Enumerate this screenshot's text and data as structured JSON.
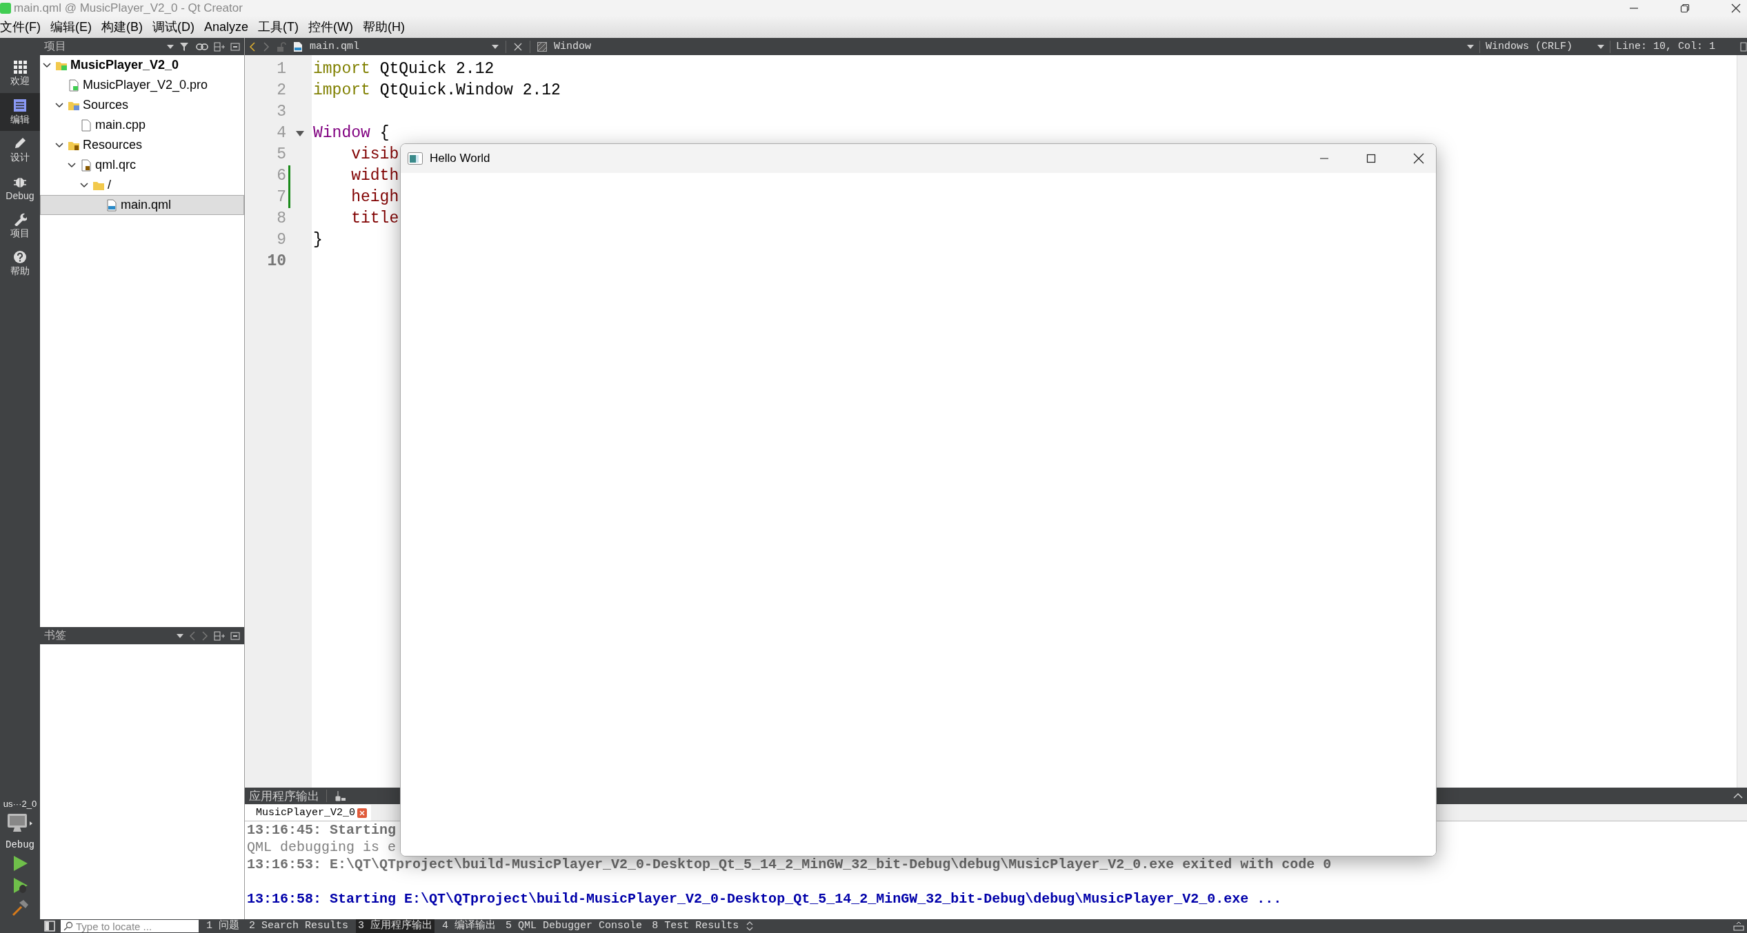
{
  "window": {
    "title": "main.qml @ MusicPlayer_V2_0 - Qt Creator"
  },
  "menu": [
    "文件(F)",
    "编辑(E)",
    "构建(B)",
    "调试(D)",
    "Analyze",
    "工具(T)",
    "控件(W)",
    "帮助(H)"
  ],
  "mode_bar": {
    "items": [
      {
        "label": "欢迎",
        "kind": "welcome",
        "selected": false
      },
      {
        "label": "编辑",
        "kind": "edit",
        "selected": true
      },
      {
        "label": "设计",
        "kind": "design",
        "selected": false
      },
      {
        "label": "Debug",
        "kind": "debug",
        "selected": false
      },
      {
        "label": "项目",
        "kind": "projects",
        "selected": false
      },
      {
        "label": "帮助",
        "kind": "help",
        "selected": false
      }
    ],
    "target": {
      "project": "us···2_0",
      "build": "Debug"
    }
  },
  "project_panel": {
    "title": "项目",
    "tree": [
      {
        "label": "MusicPlayer_V2_0",
        "kind": "project",
        "expanded": true,
        "selected": false,
        "children": [
          {
            "label": "MusicPlayer_V2_0.pro",
            "kind": "pro",
            "selected": false
          },
          {
            "label": "Sources",
            "kind": "sources",
            "expanded": true,
            "selected": false,
            "children": [
              {
                "label": "main.cpp",
                "kind": "cpp",
                "selected": false
              }
            ]
          },
          {
            "label": "Resources",
            "kind": "resources",
            "expanded": true,
            "selected": false,
            "children": [
              {
                "label": "qml.qrc",
                "kind": "qrc",
                "expanded": true,
                "selected": false,
                "children": [
                  {
                    "label": "/",
                    "kind": "folder",
                    "expanded": true,
                    "selected": false,
                    "children": [
                      {
                        "label": "main.qml",
                        "kind": "qml",
                        "selected": true
                      }
                    ]
                  }
                ]
              }
            ]
          }
        ]
      }
    ]
  },
  "bookmarks_panel": {
    "title": "书签"
  },
  "editor": {
    "file": "main.qml",
    "symbol": "Window",
    "line_ending": "Windows (CRLF)",
    "position": "Line: 10, Col: 1",
    "lines": [
      {
        "number": "1",
        "current": false,
        "modified": false,
        "foldable": false,
        "tokens": [
          {
            "kind": "keyword",
            "text": "import"
          },
          {
            "kind": "plain",
            "text": " QtQuick 2.12"
          }
        ]
      },
      {
        "number": "2",
        "current": false,
        "modified": false,
        "foldable": false,
        "tokens": [
          {
            "kind": "keyword",
            "text": "import"
          },
          {
            "kind": "plain",
            "text": " QtQuick.Window 2.12"
          }
        ]
      },
      {
        "number": "3",
        "current": false,
        "modified": false,
        "foldable": false
      },
      {
        "number": "4",
        "current": false,
        "modified": false,
        "foldable": true,
        "tokens": [
          {
            "kind": "type",
            "text": "Window"
          },
          {
            "kind": "plain",
            "text": " {"
          }
        ]
      },
      {
        "number": "5",
        "current": false,
        "modified": false,
        "foldable": false,
        "tokens": [
          {
            "kind": "property",
            "text": "    visib"
          }
        ]
      },
      {
        "number": "6",
        "current": false,
        "modified": true,
        "foldable": false,
        "tokens": [
          {
            "kind": "property",
            "text": "    width"
          }
        ]
      },
      {
        "number": "7",
        "current": false,
        "modified": true,
        "foldable": false,
        "tokens": [
          {
            "kind": "property",
            "text": "    heigh"
          }
        ]
      },
      {
        "number": "8",
        "current": false,
        "modified": false,
        "foldable": false,
        "tokens": [
          {
            "kind": "property",
            "text": "    title"
          }
        ]
      },
      {
        "number": "9",
        "current": false,
        "modified": false,
        "foldable": false,
        "tokens": [
          {
            "kind": "plain",
            "text": "}"
          }
        ]
      },
      {
        "number": "10",
        "current": true,
        "modified": false,
        "foldable": false
      }
    ]
  },
  "output_pane": {
    "title": "应用程序输出",
    "tabs": [
      {
        "label": "MusicPlayer_V2_0",
        "selected": true
      }
    ],
    "lines": [
      {
        "kind": "status",
        "text": "13:16:45: Starting"
      },
      {
        "kind": "message",
        "text": "QML debugging is e"
      },
      {
        "kind": "status",
        "text": "13:16:53: E:\\QT\\QTproject\\build-MusicPlayer_V2_0-Desktop_Qt_5_14_2_MinGW_32_bit-Debug\\debug\\MusicPlayer_V2_0.exe exited with code 0"
      },
      {
        "kind": "blank"
      },
      {
        "kind": "launch",
        "text": "13:16:58: Starting E:\\QT\\QTproject\\build-MusicPlayer_V2_0-Desktop_Qt_5_14_2_MinGW_32_bit-Debug\\debug\\MusicPlayer_V2_0.exe ..."
      }
    ]
  },
  "status_bar": {
    "search": {
      "placeholder": "Type to locate ..."
    },
    "tabs": [
      {
        "label": "1 问题",
        "selected": false
      },
      {
        "label": "2 Search Results",
        "selected": false
      },
      {
        "label": "3 应用程序输出",
        "selected": true
      },
      {
        "label": "4 编译输出",
        "selected": false
      },
      {
        "label": "5 QML Debugger Console",
        "selected": false
      },
      {
        "label": "8 Test Results",
        "selected": false
      }
    ]
  },
  "app_window": {
    "title": "Hello World"
  }
}
